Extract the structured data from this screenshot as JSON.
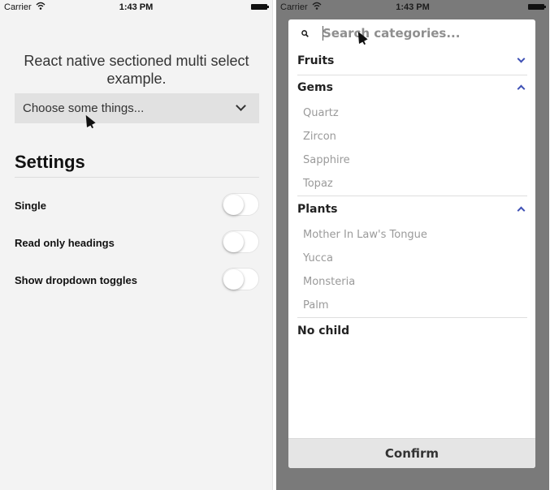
{
  "left_screen": {
    "status_bar": {
      "carrier": "Carrier",
      "time": "1:43 PM",
      "icons": [
        "wifi-icon",
        "battery-icon"
      ]
    },
    "example_title": "React native sectioned multi select example.",
    "selector": {
      "label": "Choose some things...",
      "icon": "chevron-down-icon"
    },
    "settings": {
      "title": "Settings",
      "rows": [
        {
          "label": "Single",
          "on": false
        },
        {
          "label": "Read only headings",
          "on": false
        },
        {
          "label": "Show dropdown toggles",
          "on": false
        }
      ]
    }
  },
  "right_screen": {
    "status_bar": {
      "carrier": "Carrier",
      "time": "1:43 PM",
      "icons": [
        "wifi-icon",
        "battery-icon"
      ]
    },
    "search": {
      "placeholder": "Search categories...",
      "value": "",
      "icon": "search-icon"
    },
    "categories": [
      {
        "name": "Fruits",
        "expanded": false,
        "items": []
      },
      {
        "name": "Gems",
        "expanded": true,
        "items": [
          "Quartz",
          "Zircon",
          "Sapphire",
          "Topaz"
        ]
      },
      {
        "name": "Plants",
        "expanded": true,
        "items": [
          "Mother In Law's Tongue",
          "Yucca",
          "Monsteria",
          "Palm"
        ]
      },
      {
        "name": "No child",
        "expanded": false,
        "items": []
      }
    ],
    "confirm_label": "Confirm"
  },
  "colors": {
    "accent": "#3f51b5",
    "overlay": "#7a7a7a",
    "left_background": "#f3f3f3",
    "selector_background": "#e1e1e1",
    "item_text": "#9a9a9a",
    "confirm_background": "#e5e5e5"
  }
}
